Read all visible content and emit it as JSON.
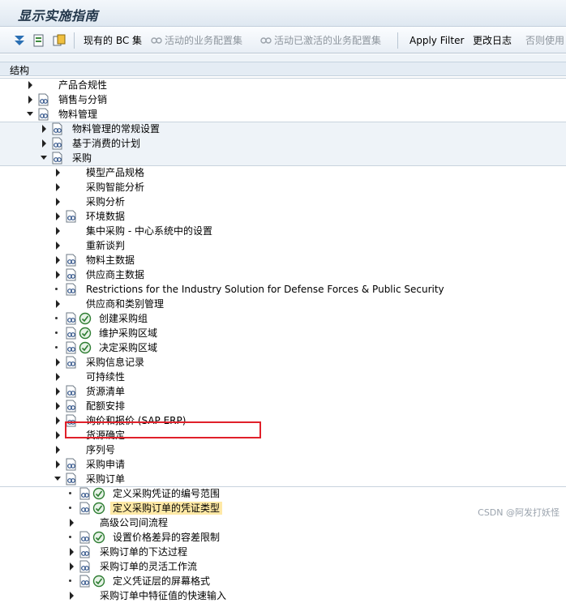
{
  "title": "显示实施指南",
  "toolbar": {
    "current_bc": "现有的 BC 集",
    "bc_active": "活动的业务配置集",
    "bc_activated": "活动已激活的业务配置集",
    "apply_filter": "Apply Filter",
    "change_log": "更改日志",
    "disabled_use": "否则使用"
  },
  "tree": {
    "header": "结构",
    "rows": [
      {
        "label": "产品合规性",
        "lvl": 0,
        "ctl": "arrow",
        "open": false,
        "doc": false,
        "exe": false
      },
      {
        "label": "销售与分销",
        "lvl": 0,
        "ctl": "arrow",
        "open": false,
        "doc": true,
        "exe": false
      },
      {
        "label": "物料管理",
        "lvl": 0,
        "ctl": "arrow",
        "open": true,
        "doc": true,
        "exe": false
      },
      {
        "label": "物料管理的常规设置",
        "lvl": 1,
        "ctl": "arrow",
        "open": false,
        "doc": true,
        "exe": false
      },
      {
        "label": "基于消费的计划",
        "lvl": 1,
        "ctl": "arrow",
        "open": false,
        "doc": true,
        "exe": false
      },
      {
        "label": "采购",
        "lvl": 1,
        "ctl": "arrow",
        "open": true,
        "doc": true,
        "exe": false
      },
      {
        "label": "模型产品规格",
        "lvl": 2,
        "ctl": "arrow",
        "open": false,
        "doc": false,
        "exe": false
      },
      {
        "label": "采购智能分析",
        "lvl": 2,
        "ctl": "arrow",
        "open": false,
        "doc": false,
        "exe": false
      },
      {
        "label": "采购分析",
        "lvl": 2,
        "ctl": "arrow",
        "open": false,
        "doc": false,
        "exe": false
      },
      {
        "label": "环境数据",
        "lvl": 2,
        "ctl": "arrow",
        "open": false,
        "doc": true,
        "exe": false
      },
      {
        "label": "集中采购 - 中心系统中的设置",
        "lvl": 2,
        "ctl": "arrow",
        "open": false,
        "doc": false,
        "exe": false
      },
      {
        "label": "重新谈判",
        "lvl": 2,
        "ctl": "arrow",
        "open": false,
        "doc": false,
        "exe": false
      },
      {
        "label": "物料主数据",
        "lvl": 2,
        "ctl": "arrow",
        "open": false,
        "doc": true,
        "exe": false
      },
      {
        "label": "供应商主数据",
        "lvl": 2,
        "ctl": "arrow",
        "open": false,
        "doc": true,
        "exe": false
      },
      {
        "label": "Restrictions for the Industry Solution for Defense Forces & Public Security",
        "lvl": 2,
        "ctl": "dot",
        "open": false,
        "doc": true,
        "exe": false
      },
      {
        "label": "供应商和类别管理",
        "lvl": 2,
        "ctl": "arrow",
        "open": false,
        "doc": false,
        "exe": false
      },
      {
        "label": "创建采购组",
        "lvl": 2,
        "ctl": "dot",
        "open": false,
        "doc": true,
        "exe": true
      },
      {
        "label": "维护采购区域",
        "lvl": 2,
        "ctl": "dot",
        "open": false,
        "doc": true,
        "exe": true
      },
      {
        "label": "决定采购区域",
        "lvl": 2,
        "ctl": "dot",
        "open": false,
        "doc": true,
        "exe": true
      },
      {
        "label": "采购信息记录",
        "lvl": 2,
        "ctl": "arrow",
        "open": false,
        "doc": true,
        "exe": false
      },
      {
        "label": "可持续性",
        "lvl": 2,
        "ctl": "arrow",
        "open": false,
        "doc": false,
        "exe": false
      },
      {
        "label": "货源清单",
        "lvl": 2,
        "ctl": "arrow",
        "open": false,
        "doc": true,
        "exe": false
      },
      {
        "label": "配额安排",
        "lvl": 2,
        "ctl": "arrow",
        "open": false,
        "doc": true,
        "exe": false
      },
      {
        "label": "询价和报价 (SAP ERP)",
        "lvl": 2,
        "ctl": "arrow",
        "open": false,
        "doc": true,
        "exe": false
      },
      {
        "label": "货源确定",
        "lvl": 2,
        "ctl": "arrow",
        "open": false,
        "doc": false,
        "exe": false
      },
      {
        "label": "序列号",
        "lvl": 2,
        "ctl": "arrow",
        "open": false,
        "doc": false,
        "exe": false
      },
      {
        "label": "采购申请",
        "lvl": 2,
        "ctl": "arrow",
        "open": false,
        "doc": true,
        "exe": false
      },
      {
        "label": "采购订单",
        "lvl": 2,
        "ctl": "arrow",
        "open": true,
        "doc": true,
        "exe": false
      },
      {
        "label": "定义采购凭证的编号范围",
        "lvl": 3,
        "ctl": "dot",
        "open": false,
        "doc": true,
        "exe": true
      },
      {
        "label": "定义采购订单的凭证类型",
        "lvl": 3,
        "ctl": "dot",
        "open": false,
        "doc": true,
        "exe": true,
        "selected": true
      },
      {
        "label": "高级公司间流程",
        "lvl": 3,
        "ctl": "arrow",
        "open": false,
        "doc": false,
        "exe": false
      },
      {
        "label": "设置价格差异的容差限制",
        "lvl": 3,
        "ctl": "dot",
        "open": false,
        "doc": true,
        "exe": true
      },
      {
        "label": "采购订单的下达过程",
        "lvl": 3,
        "ctl": "arrow",
        "open": false,
        "doc": true,
        "exe": false
      },
      {
        "label": "采购订单的灵活工作流",
        "lvl": 3,
        "ctl": "arrow",
        "open": false,
        "doc": true,
        "exe": false
      },
      {
        "label": "定义凭证层的屏幕格式",
        "lvl": 3,
        "ctl": "dot",
        "open": false,
        "doc": true,
        "exe": true
      },
      {
        "label": "采购订单中特征值的快速输入",
        "lvl": 3,
        "ctl": "arrow",
        "open": false,
        "doc": false,
        "exe": false
      }
    ]
  },
  "watermark": "CSDN @阿发打妖怪",
  "colors": {
    "band_level0": "#ffffff",
    "band_level1": "#eef3f8",
    "band_level2": "#ffffff",
    "band_level3": "#ffffff",
    "selection": "#ffe9a6",
    "highlight_box": "#e0202a",
    "execute_icon": "#2e7d32"
  },
  "icons": {
    "toolbar": [
      "expand-all-icon",
      "doc-nav-icon",
      "bc-set-icon",
      "bc-active-icon",
      "bc-activated-icon"
    ],
    "tree": [
      "expand-arrow-icon",
      "collapse-arrow-icon",
      "bullet-icon",
      "documentation-icon",
      "execute-clock-icon"
    ]
  }
}
